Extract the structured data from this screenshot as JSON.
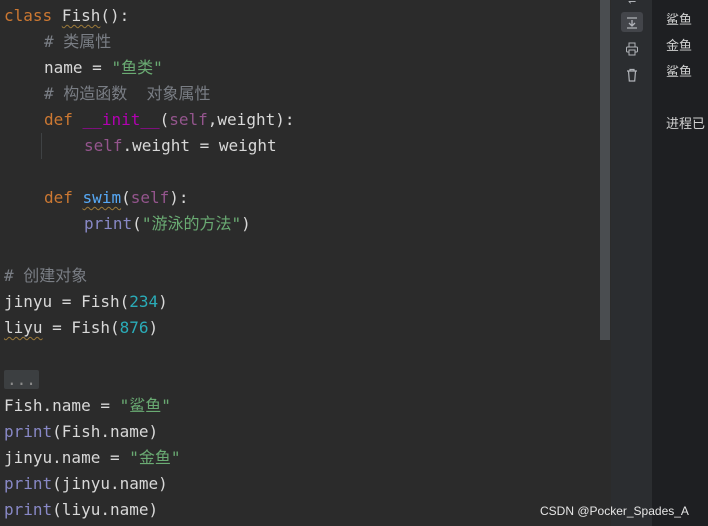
{
  "code": {
    "l1": {
      "kw": "class",
      "name": "Fish",
      "paren": "():"
    },
    "l2": "# 类属性",
    "l3": {
      "ident": "name",
      "op": " = ",
      "str": "\"鱼类\""
    },
    "l4": "# 构造函数  对象属性",
    "l5": {
      "kw": "def",
      "name": "__init__",
      "open": "(",
      "self": "self",
      "rest": ",weight):"
    },
    "l6": {
      "self": "self",
      "rest": ".weight = weight"
    },
    "l8": {
      "kw": "def",
      "name": "swim",
      "open": "(",
      "self": "self",
      "close": "):"
    },
    "l9": {
      "func": "print",
      "open": "(",
      "str": "\"游泳的方法\"",
      "close": ")"
    },
    "l11": "# 创建对象",
    "l12": {
      "ident": "jinyu",
      "op": " = Fish(",
      "num": "234",
      "close": ")"
    },
    "l13": {
      "ident": "liyu",
      "op": " = Fish(",
      "num": "876",
      "close": ")"
    },
    "l15": "...",
    "l16": {
      "ident": "Fish.name",
      "op": " = ",
      "str": "\"鲨鱼\""
    },
    "l17": {
      "func": "print",
      "rest": "(Fish.name)"
    },
    "l18": {
      "ident": "jinyu.name",
      "op": " = ",
      "str": "\"金鱼\""
    },
    "l19": {
      "func": "print",
      "rest": "(jinyu.name)"
    },
    "l20": {
      "func": "print",
      "rest": "(liyu.name)"
    }
  },
  "output": {
    "lines": [
      "鲨鱼",
      "金鱼",
      "鲨鱼"
    ],
    "exit": "进程已"
  },
  "toolbar": {
    "icons": [
      "soft-wrap-icon",
      "scroll-to-end-icon",
      "print-icon",
      "trash-icon"
    ]
  },
  "watermark": "CSDN @Pocker_Spades_A"
}
